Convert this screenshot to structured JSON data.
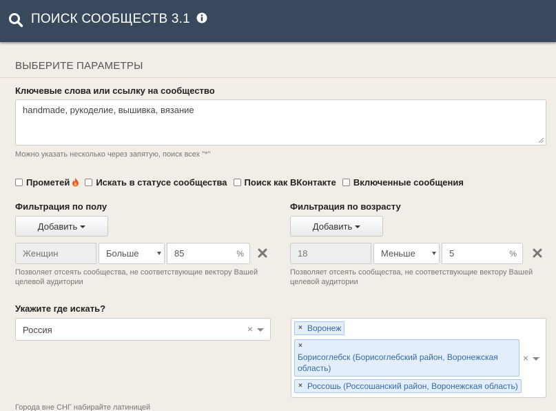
{
  "header": {
    "title": "ПОИСК СООБЩЕСТВ 3.1",
    "search_icon": "search-icon",
    "info_icon": "info-icon"
  },
  "section_title": "ВЫБЕРИТЕ ПАРАМЕТРЫ",
  "keywords": {
    "label": "Ключевые слова или ссылку на сообщество",
    "value": "handmade, рукоделие, вышивка, вязание",
    "hint": "Можно указать несколько через запятую, поиск всех \"*\""
  },
  "checkboxes": [
    {
      "label": "Прометей",
      "checked": false
    },
    {
      "label": "Искать в статусе сообщества",
      "checked": false
    },
    {
      "label": "Поиск как ВКонтакте",
      "checked": false
    },
    {
      "label": "Включенные сообщения",
      "checked": false
    }
  ],
  "gender_filter": {
    "label": "Фильтрация по полу",
    "add_label": "Добавить",
    "value": "Женщин",
    "operator": "Больше",
    "amount": "85",
    "unit": "%",
    "hint": "Позволяет отсеять сообщества, не соответствующие вектору Вашей целевой аудитории"
  },
  "age_filter": {
    "label": "Фильтрация по возрасту",
    "add_label": "Добавить",
    "value": "18",
    "operator": "Меньше",
    "amount": "5",
    "unit": "%",
    "hint": "Позволяет отсеять сообщества, не соответствующие вектору Вашей целевой аудитории"
  },
  "location": {
    "label": "Укажите где искать?",
    "country": "Россия",
    "clear": "×",
    "cities": [
      "Воронеж",
      "Борисоглебск (Борисоглебский район, Воронежская область)",
      "Россошь (Россошанский район, Воронежская область)"
    ],
    "hint": "Города вне СНГ набирайте латиницей"
  },
  "colors": {
    "header_bg": "#39495d",
    "page_bg": "#f2ede6",
    "tag_bg": "#e4eefa",
    "tag_text": "#336aa6"
  }
}
